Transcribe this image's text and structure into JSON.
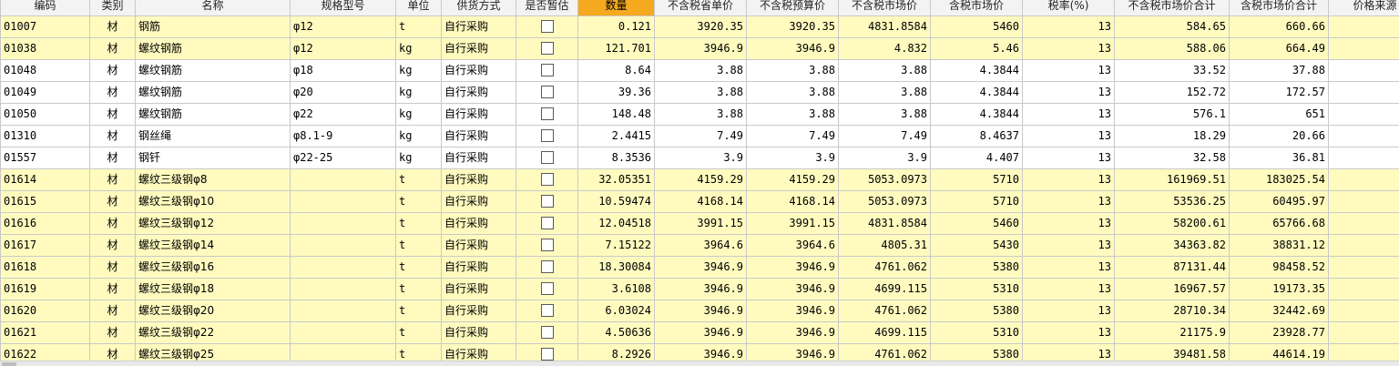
{
  "grid": {
    "columns": [
      "编码",
      "类别",
      "名称",
      "规格型号",
      "单位",
      "供货方式",
      "是否暂估",
      "数量",
      "不含税省单价",
      "不含税预算价",
      "不含税市场价",
      "含税市场价",
      "税率(%)",
      "不含税市场价合计",
      "含税市场价合计",
      "价格来源"
    ],
    "active_column": "数量",
    "rows": [
      {
        "code": "01007",
        "type": "材",
        "name": "钢筋",
        "spec": "φ12",
        "unit": "t",
        "supply": "自行采购",
        "est": false,
        "qty": "0.121",
        "prov_price": "3920.35",
        "budget_price": "3920.35",
        "market_price": "4831.8584",
        "market_price_tax": "5460",
        "tax_rate": "13",
        "market_total": "584.65",
        "market_total_tax": "660.66",
        "source": "",
        "highlight": true
      },
      {
        "code": "01038",
        "type": "材",
        "name": "螺纹钢筋",
        "spec": "φ12",
        "unit": "kg",
        "supply": "自行采购",
        "est": false,
        "qty": "121.701",
        "prov_price": "3946.9",
        "budget_price": "3946.9",
        "market_price": "4.832",
        "market_price_tax": "5.46",
        "tax_rate": "13",
        "market_total": "588.06",
        "market_total_tax": "664.49",
        "source": "",
        "highlight": true
      },
      {
        "code": "01048",
        "type": "材",
        "name": "螺纹钢筋",
        "spec": "φ18",
        "unit": "kg",
        "supply": "自行采购",
        "est": false,
        "qty": "8.64",
        "prov_price": "3.88",
        "budget_price": "3.88",
        "market_price": "3.88",
        "market_price_tax": "4.3844",
        "tax_rate": "13",
        "market_total": "33.52",
        "market_total_tax": "37.88",
        "source": "",
        "highlight": false
      },
      {
        "code": "01049",
        "type": "材",
        "name": "螺纹钢筋",
        "spec": "φ20",
        "unit": "kg",
        "supply": "自行采购",
        "est": false,
        "qty": "39.36",
        "prov_price": "3.88",
        "budget_price": "3.88",
        "market_price": "3.88",
        "market_price_tax": "4.3844",
        "tax_rate": "13",
        "market_total": "152.72",
        "market_total_tax": "172.57",
        "source": "",
        "highlight": false
      },
      {
        "code": "01050",
        "type": "材",
        "name": "螺纹钢筋",
        "spec": "φ22",
        "unit": "kg",
        "supply": "自行采购",
        "est": false,
        "qty": "148.48",
        "prov_price": "3.88",
        "budget_price": "3.88",
        "market_price": "3.88",
        "market_price_tax": "4.3844",
        "tax_rate": "13",
        "market_total": "576.1",
        "market_total_tax": "651",
        "source": "",
        "highlight": false
      },
      {
        "code": "01310",
        "type": "材",
        "name": "钢丝绳",
        "spec": "φ8.1-9",
        "unit": "kg",
        "supply": "自行采购",
        "est": false,
        "qty": "2.4415",
        "prov_price": "7.49",
        "budget_price": "7.49",
        "market_price": "7.49",
        "market_price_tax": "8.4637",
        "tax_rate": "13",
        "market_total": "18.29",
        "market_total_tax": "20.66",
        "source": "",
        "highlight": false
      },
      {
        "code": "01557",
        "type": "材",
        "name": "钢钎",
        "spec": "φ22-25",
        "unit": "kg",
        "supply": "自行采购",
        "est": false,
        "qty": "8.3536",
        "prov_price": "3.9",
        "budget_price": "3.9",
        "market_price": "3.9",
        "market_price_tax": "4.407",
        "tax_rate": "13",
        "market_total": "32.58",
        "market_total_tax": "36.81",
        "source": "",
        "highlight": false
      },
      {
        "code": "01614",
        "type": "材",
        "name": "螺纹三级钢φ8",
        "spec": "",
        "unit": "t",
        "supply": "自行采购",
        "est": false,
        "qty": "32.05351",
        "prov_price": "4159.29",
        "budget_price": "4159.29",
        "market_price": "5053.0973",
        "market_price_tax": "5710",
        "tax_rate": "13",
        "market_total": "161969.51",
        "market_total_tax": "183025.54",
        "source": "",
        "highlight": true
      },
      {
        "code": "01615",
        "type": "材",
        "name": "螺纹三级钢φ10",
        "spec": "",
        "unit": "t",
        "supply": "自行采购",
        "est": false,
        "qty": "10.59474",
        "prov_price": "4168.14",
        "budget_price": "4168.14",
        "market_price": "5053.0973",
        "market_price_tax": "5710",
        "tax_rate": "13",
        "market_total": "53536.25",
        "market_total_tax": "60495.97",
        "source": "",
        "highlight": true
      },
      {
        "code": "01616",
        "type": "材",
        "name": "螺纹三级钢φ12",
        "spec": "",
        "unit": "t",
        "supply": "自行采购",
        "est": false,
        "qty": "12.04518",
        "prov_price": "3991.15",
        "budget_price": "3991.15",
        "market_price": "4831.8584",
        "market_price_tax": "5460",
        "tax_rate": "13",
        "market_total": "58200.61",
        "market_total_tax": "65766.68",
        "source": "",
        "highlight": true
      },
      {
        "code": "01617",
        "type": "材",
        "name": "螺纹三级钢φ14",
        "spec": "",
        "unit": "t",
        "supply": "自行采购",
        "est": false,
        "qty": "7.15122",
        "prov_price": "3964.6",
        "budget_price": "3964.6",
        "market_price": "4805.31",
        "market_price_tax": "5430",
        "tax_rate": "13",
        "market_total": "34363.82",
        "market_total_tax": "38831.12",
        "source": "",
        "highlight": true
      },
      {
        "code": "01618",
        "type": "材",
        "name": "螺纹三级钢φ16",
        "spec": "",
        "unit": "t",
        "supply": "自行采购",
        "est": false,
        "qty": "18.30084",
        "prov_price": "3946.9",
        "budget_price": "3946.9",
        "market_price": "4761.062",
        "market_price_tax": "5380",
        "tax_rate": "13",
        "market_total": "87131.44",
        "market_total_tax": "98458.52",
        "source": "",
        "highlight": true
      },
      {
        "code": "01619",
        "type": "材",
        "name": "螺纹三级钢φ18",
        "spec": "",
        "unit": "t",
        "supply": "自行采购",
        "est": false,
        "qty": "3.6108",
        "prov_price": "3946.9",
        "budget_price": "3946.9",
        "market_price": "4699.115",
        "market_price_tax": "5310",
        "tax_rate": "13",
        "market_total": "16967.57",
        "market_total_tax": "19173.35",
        "source": "",
        "highlight": true
      },
      {
        "code": "01620",
        "type": "材",
        "name": "螺纹三级钢φ20",
        "spec": "",
        "unit": "t",
        "supply": "自行采购",
        "est": false,
        "qty": "6.03024",
        "prov_price": "3946.9",
        "budget_price": "3946.9",
        "market_price": "4761.062",
        "market_price_tax": "5380",
        "tax_rate": "13",
        "market_total": "28710.34",
        "market_total_tax": "32442.69",
        "source": "",
        "highlight": true
      },
      {
        "code": "01621",
        "type": "材",
        "name": "螺纹三级钢φ22",
        "spec": "",
        "unit": "t",
        "supply": "自行采购",
        "est": false,
        "qty": "4.50636",
        "prov_price": "3946.9",
        "budget_price": "3946.9",
        "market_price": "4699.115",
        "market_price_tax": "5310",
        "tax_rate": "13",
        "market_total": "21175.9",
        "market_total_tax": "23928.77",
        "source": "",
        "highlight": true
      },
      {
        "code": "01622",
        "type": "材",
        "name": "螺纹三级钢φ25",
        "spec": "",
        "unit": "t",
        "supply": "自行采购",
        "est": false,
        "qty": "8.2926",
        "prov_price": "3946.9",
        "budget_price": "3946.9",
        "market_price": "4761.062",
        "market_price_tax": "5380",
        "tax_rate": "13",
        "market_total": "39481.58",
        "market_total_tax": "44614.19",
        "source": "",
        "highlight": true
      }
    ]
  },
  "colors": {
    "highlight_row": "#fffbbf",
    "active_header": "#f5a91f",
    "grid_line": "#c9c9c9"
  }
}
